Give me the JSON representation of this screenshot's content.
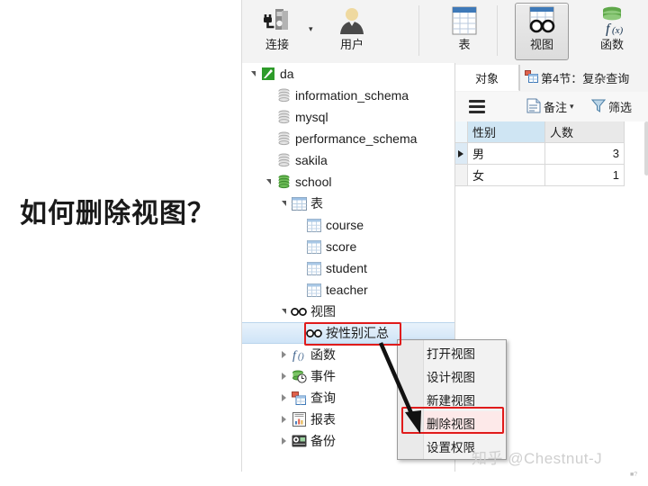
{
  "annotation": {
    "question": "如何删除视图？",
    "arrow_icon": "arrow-down-right-icon"
  },
  "watermark": {
    "text": "知乎 @Chestnut-J",
    "corner": "■?"
  },
  "ribbon": {
    "items": [
      {
        "label": "连接",
        "icon": "connect-server-icon",
        "selected": false,
        "has_dropdown": true
      },
      {
        "label": "用户",
        "icon": "user-icon",
        "selected": false,
        "has_dropdown": false
      },
      {
        "label": "表",
        "icon": "table-icon",
        "selected": false,
        "has_dropdown": false
      },
      {
        "label": "视图",
        "icon": "view-glasses-icon",
        "selected": true,
        "has_dropdown": false
      },
      {
        "label": "函数",
        "icon": "function-fx-icon",
        "selected": false,
        "has_dropdown": false
      }
    ]
  },
  "tabs": [
    {
      "label": "对象",
      "icon": "",
      "active": true
    },
    {
      "label": "第4节：复杂查询",
      "icon": "query-table-icon",
      "active": false
    }
  ],
  "grid_toolbar": {
    "menu_icon": "hamburger-icon",
    "items": [
      {
        "label": "备注",
        "icon": "note-icon",
        "has_dropdown": true
      },
      {
        "label": "筛选",
        "icon": "filter-funnel-icon",
        "has_dropdown": false
      }
    ]
  },
  "data_grid": {
    "columns": [
      "性别",
      "人数"
    ],
    "rows": [
      {
        "性别": "男",
        "人数": "3",
        "current": true
      },
      {
        "性别": "女",
        "人数": "1",
        "current": false
      }
    ]
  },
  "tree": {
    "nodes": [
      {
        "label": "da",
        "icon": "connection-green-icon",
        "indent": 0,
        "twist": "open",
        "selected": false
      },
      {
        "label": "information_schema",
        "icon": "database-gray-icon",
        "indent": 1,
        "twist": "none",
        "selected": false
      },
      {
        "label": "mysql",
        "icon": "database-gray-icon",
        "indent": 1,
        "twist": "none",
        "selected": false
      },
      {
        "label": "performance_schema",
        "icon": "database-gray-icon",
        "indent": 1,
        "twist": "none",
        "selected": false
      },
      {
        "label": "sakila",
        "icon": "database-gray-icon",
        "indent": 1,
        "twist": "none",
        "selected": false
      },
      {
        "label": "school",
        "icon": "database-green-icon",
        "indent": 1,
        "twist": "open",
        "selected": false
      },
      {
        "label": "表",
        "icon": "table-folder-icon",
        "indent": 2,
        "twist": "open",
        "selected": false
      },
      {
        "label": "course",
        "icon": "table-icon",
        "indent": 3,
        "twist": "none",
        "selected": false
      },
      {
        "label": "score",
        "icon": "table-icon",
        "indent": 3,
        "twist": "none",
        "selected": false
      },
      {
        "label": "student",
        "icon": "table-icon",
        "indent": 3,
        "twist": "none",
        "selected": false
      },
      {
        "label": "teacher",
        "icon": "table-icon",
        "indent": 3,
        "twist": "none",
        "selected": false
      },
      {
        "label": "视图",
        "icon": "view-glasses-icon",
        "indent": 2,
        "twist": "open",
        "selected": false
      },
      {
        "label": "按性别汇总",
        "icon": "view-glasses-icon",
        "indent": 3,
        "twist": "none",
        "selected": true
      },
      {
        "label": "函数",
        "icon": "function-fx-icon",
        "indent": 2,
        "twist": "closed",
        "selected": false
      },
      {
        "label": "事件",
        "icon": "event-clock-icon",
        "indent": 2,
        "twist": "closed",
        "selected": false
      },
      {
        "label": "查询",
        "icon": "query-table-icon",
        "indent": 2,
        "twist": "closed",
        "selected": false
      },
      {
        "label": "报表",
        "icon": "report-icon",
        "indent": 2,
        "twist": "closed",
        "selected": false
      },
      {
        "label": "备份",
        "icon": "backup-icon",
        "indent": 2,
        "twist": "closed",
        "selected": false
      }
    ]
  },
  "context_menu": {
    "items": [
      {
        "label": "打开视图",
        "icon": "open-view-icon",
        "highlighted": false
      },
      {
        "label": "设计视图",
        "icon": "design-view-icon",
        "highlighted": false
      },
      {
        "label": "新建视图",
        "icon": "new-view-icon",
        "highlighted": false
      },
      {
        "label": "删除视图",
        "icon": "delete-view-icon",
        "highlighted": true
      },
      {
        "label": "设置权限",
        "icon": "",
        "highlighted": false
      }
    ]
  },
  "colors": {
    "highlight_red": "#e01b1b",
    "selection_blue": "#cfe4f7",
    "header_blue": "#cfe5f3",
    "accent_green": "#3a9a34"
  }
}
